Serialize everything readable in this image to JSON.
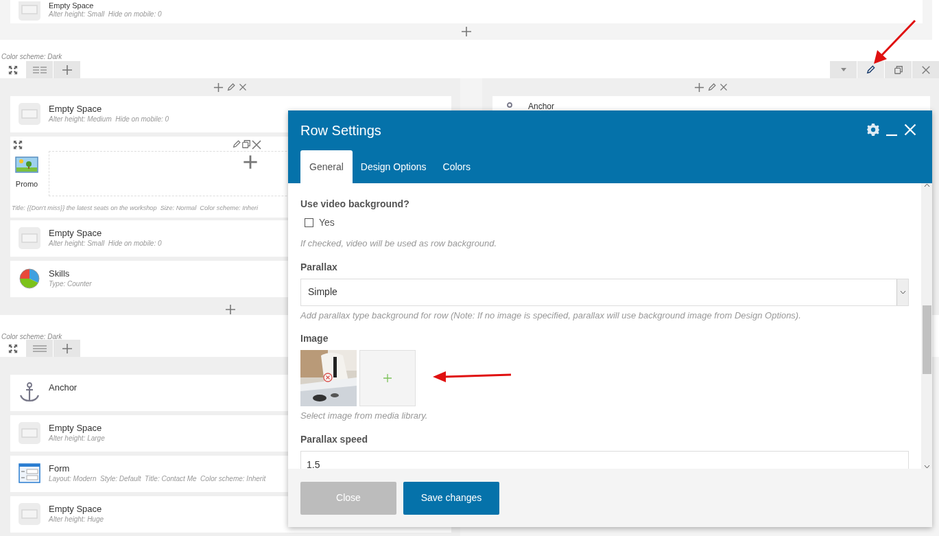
{
  "top_row": {
    "elements": [
      {
        "kind": "empty",
        "title": "Empty Space",
        "params": "Alter height: Small  Hide on mobile: 0"
      }
    ]
  },
  "rows": [
    {
      "color_scheme": "Color scheme: Dark",
      "controls_visible": true,
      "columns": [
        {
          "controls_visible": true,
          "elements": [
            {
              "kind": "empty",
              "title": "Empty Space",
              "params": "Alter height: Medium  Hide on mobile: 0"
            },
            {
              "kind": "container",
              "title": "Promo",
              "params": "Title: {{Don't miss}} the latest seats on the workshop  Size: Normal  Color scheme: Inheri"
            },
            {
              "kind": "empty",
              "title": "Empty Space",
              "params": "Alter height: Small  Hide on mobile: 0"
            },
            {
              "kind": "skills",
              "title": "Skills",
              "params": "Type: Counter"
            }
          ]
        },
        {
          "controls_visible": true,
          "elements": [
            {
              "kind": "anchor",
              "title": "Anchor"
            }
          ]
        }
      ]
    },
    {
      "color_scheme": "Color scheme: Dark",
      "controls_visible": false,
      "columns": [
        {
          "controls_visible": false,
          "elements": [
            {
              "kind": "anchor",
              "title": "Anchor"
            },
            {
              "kind": "empty",
              "title": "Empty Space",
              "params": "Alter height: Large"
            },
            {
              "kind": "form",
              "title": "Form",
              "params": "Layout: Modern  Style: Default  Title: Contact Me  Color scheme: Inherit"
            },
            {
              "kind": "empty",
              "title": "Empty Space",
              "params": "Alter height: Huge"
            }
          ]
        }
      ]
    }
  ],
  "modal": {
    "title": "Row Settings",
    "tabs": [
      {
        "label": "General",
        "selected": true
      },
      {
        "label": "Design Options",
        "selected": false
      },
      {
        "label": "Colors",
        "selected": false
      }
    ],
    "fields": [
      {
        "kind": "checkbox",
        "label": "Use video background?",
        "option": "Yes",
        "checked": false,
        "help": "If checked, video will be used as row background."
      },
      {
        "kind": "select",
        "label": "Parallax",
        "value": "Simple",
        "help": "Add parallax type background for row (Note: If no image is specified, parallax will use background image from Design Options)."
      },
      {
        "label": "Image",
        "help": "Select image from media library."
      },
      {
        "kind": "text",
        "label": "Parallax speed",
        "value": "1.5"
      }
    ],
    "buttons": [
      {
        "label": "Close",
        "kind": "secondary"
      },
      {
        "label": "Save changes",
        "kind": "primary"
      }
    ]
  }
}
